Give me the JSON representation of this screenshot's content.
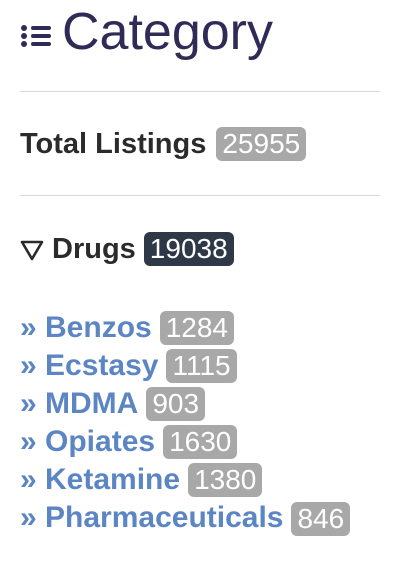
{
  "header": {
    "title": "Category",
    "icon": "list-icon"
  },
  "total": {
    "label": "Total Listings",
    "count": "25955"
  },
  "group": {
    "label": "Drugs",
    "count": "19038",
    "icon": "collapse-triangle-icon"
  },
  "subcategories": [
    {
      "label": "» Benzos",
      "count": "1284"
    },
    {
      "label": "» Ecstasy",
      "count": "1115"
    },
    {
      "label": "» MDMA",
      "count": "903"
    },
    {
      "label": "» Opiates",
      "count": "1630"
    },
    {
      "label": "» Ketamine",
      "count": "1380"
    },
    {
      "label": "» Pharmaceuticals",
      "count": "846"
    }
  ],
  "colors": {
    "title": "#2f2b56",
    "link": "#5b86c3",
    "badge_light": "#a8a8a8",
    "badge_dark": "#2e3846"
  }
}
